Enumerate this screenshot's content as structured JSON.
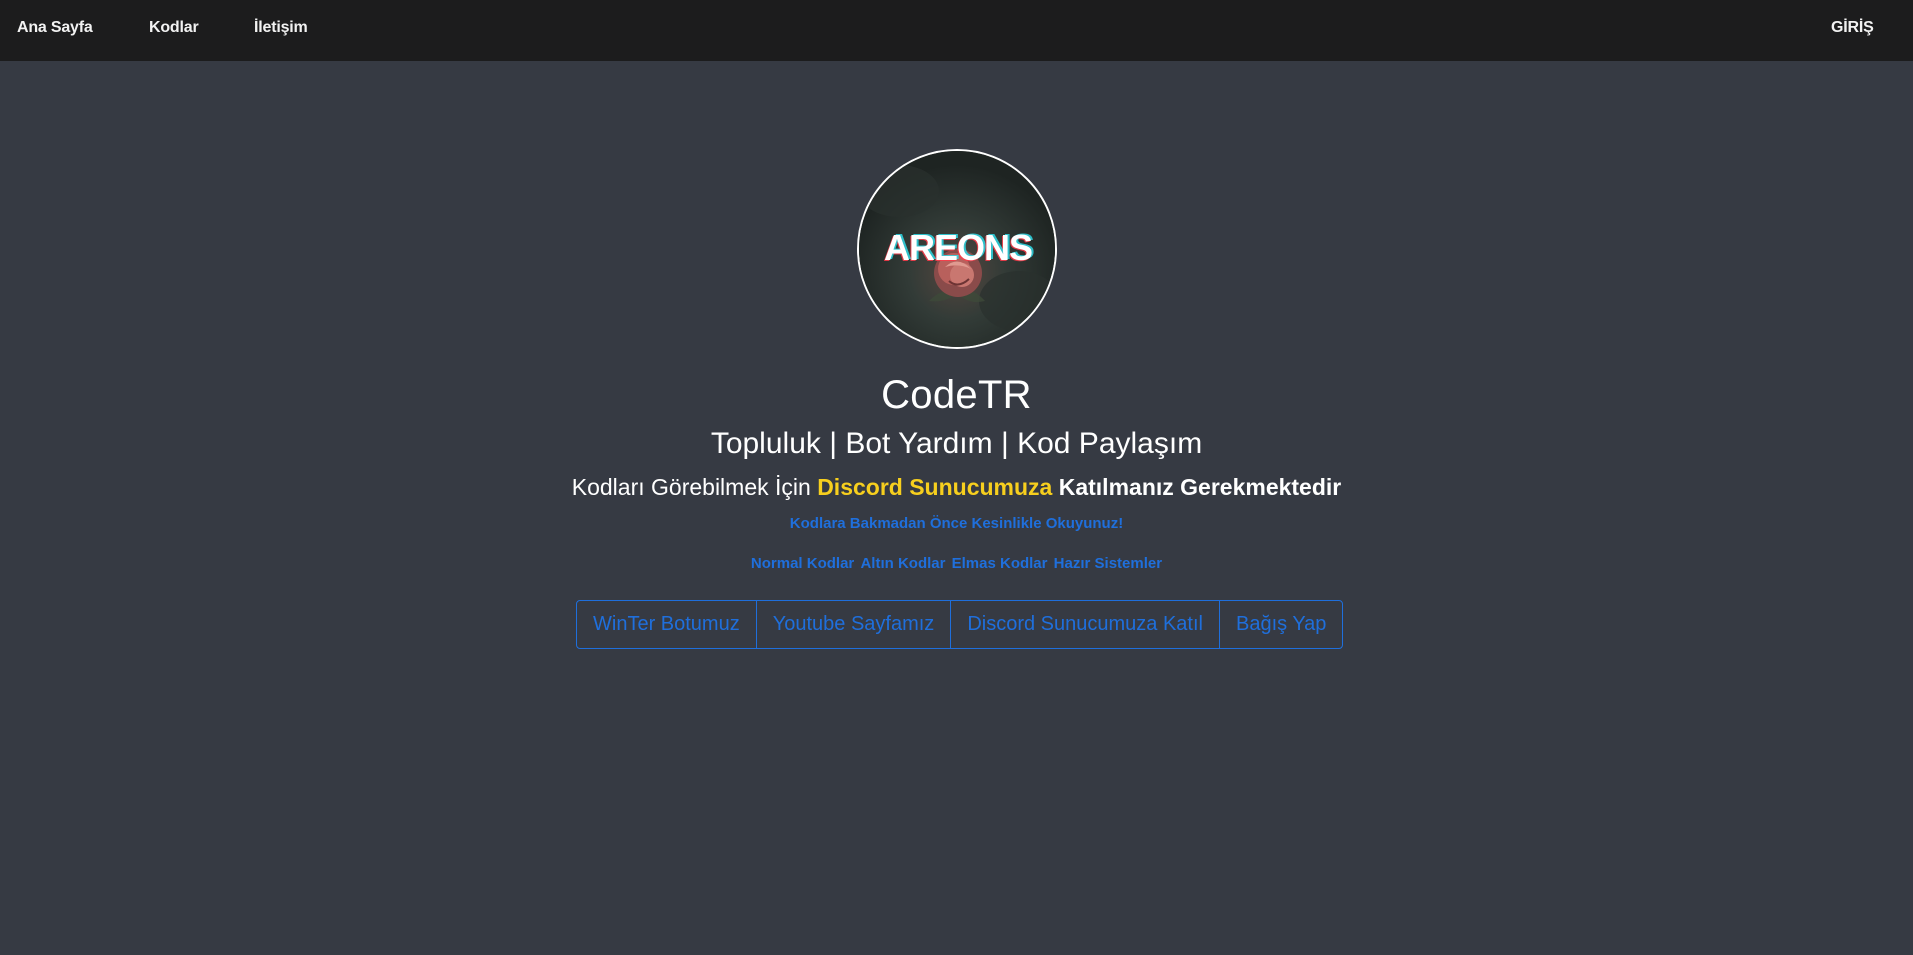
{
  "nav": {
    "home": "Ana Sayfa",
    "codes": "Kodlar",
    "contact": "İletişim",
    "login": "GİRİŞ"
  },
  "hero": {
    "avatar_text": "AREONS",
    "title": "CodeTR",
    "subtitle": "Topluluk | Bot Yardım | Kod Paylaşım",
    "notice_prefix": "Kodları Görebilmek İçin",
    "notice_highlight": "Discord Sunucumuza",
    "notice_suffix": "Katılmanız Gerekmektedir",
    "read_link": "Kodlara Bakmadan Önce Kesinlikle Okuyunuz!",
    "categories": [
      "Normal Kodlar",
      "Altın Kodlar",
      "Elmas Kodlar",
      "Hazır Sistemler"
    ]
  },
  "buttons": [
    "WinTer Botumuz",
    "Youtube Sayfamız",
    "Discord Sunucumuza Katıl",
    "Bağış Yap"
  ],
  "colors": {
    "background": "#363a43",
    "navbar": "#1c1c1d",
    "accent_blue": "#1f6fdc",
    "highlight_yellow": "#f7cf1e"
  }
}
